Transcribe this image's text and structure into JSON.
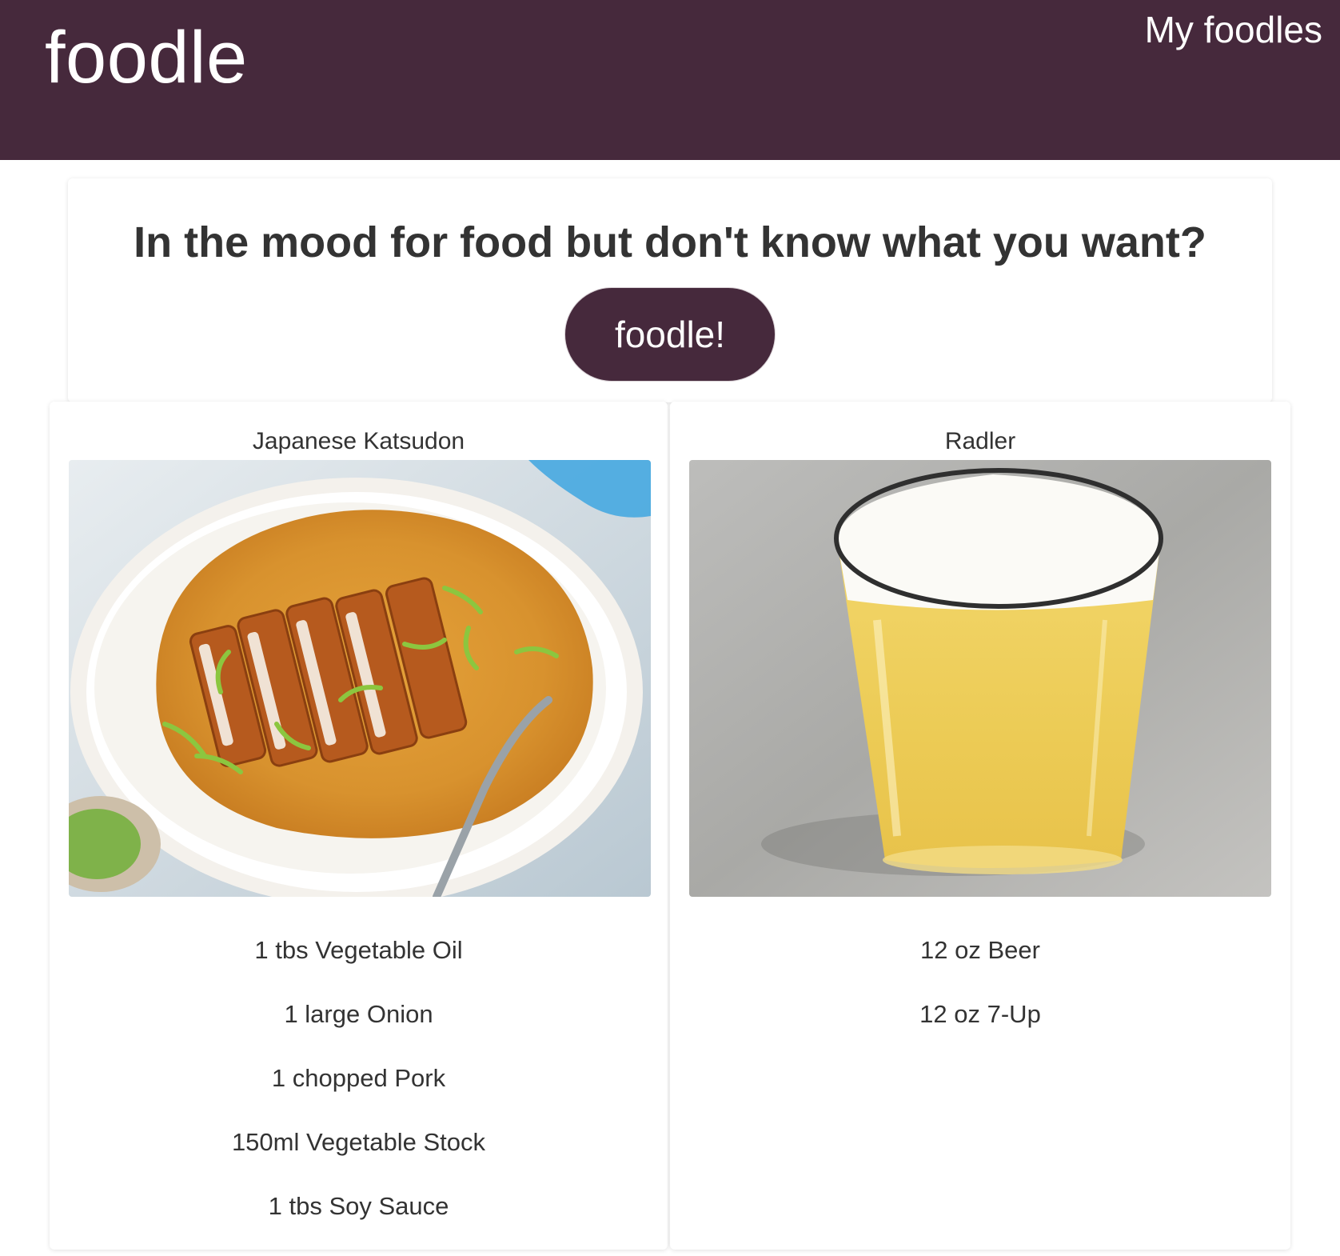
{
  "header": {
    "logo": "foodle",
    "nav_link": "My foodles",
    "background_color": "#46293c"
  },
  "hero": {
    "title": "In the mood for food but don't know what you want?",
    "button_label": "foodle!"
  },
  "recipes": [
    {
      "title": "Japanese Katsudon",
      "image_icon": "katsudon-photo-icon",
      "ingredients": [
        "1 tbs Vegetable Oil",
        "1 large Onion",
        "1 chopped Pork",
        "150ml Vegetable Stock",
        "1 tbs Soy Sauce"
      ]
    },
    {
      "title": "Radler",
      "image_icon": "radler-photo-icon",
      "ingredients": [
        "12 oz Beer",
        "12 oz 7-Up"
      ]
    }
  ]
}
